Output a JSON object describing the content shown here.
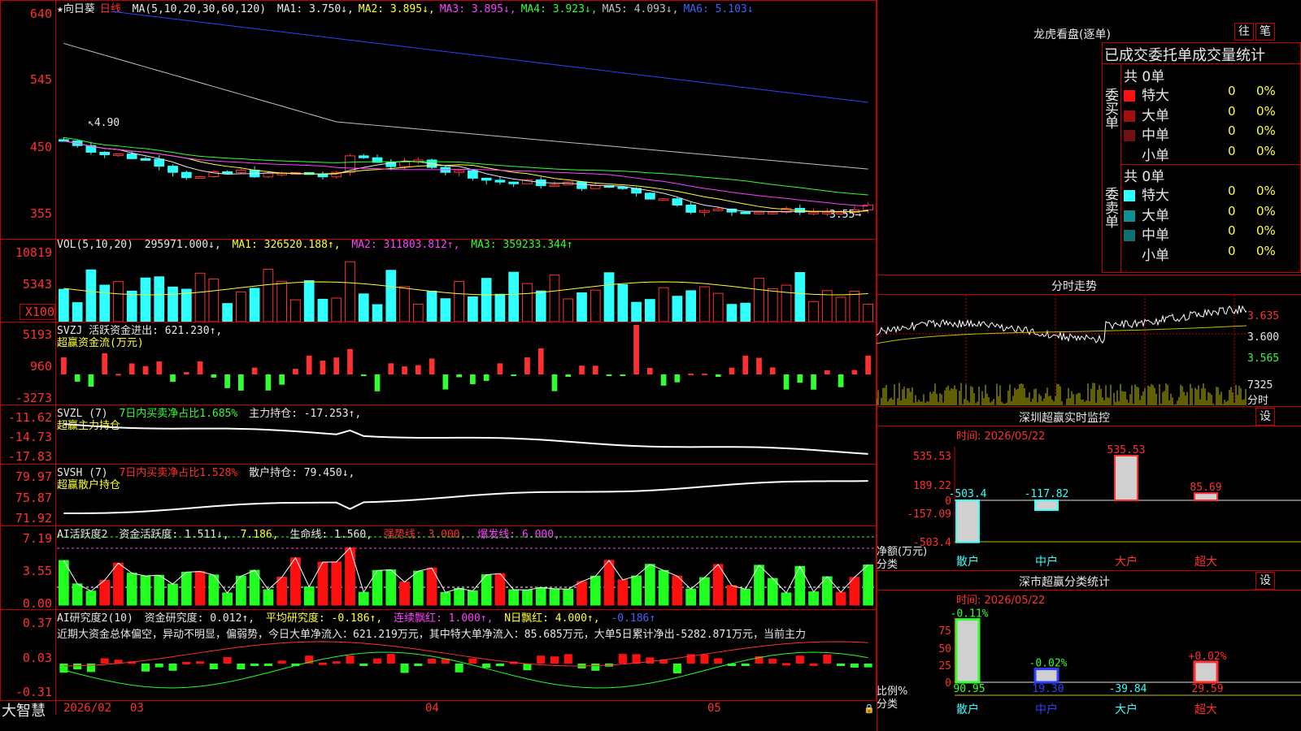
{
  "main": {
    "stock_name": "★向日葵",
    "period": "日线",
    "ma_label": "MA(5,10,20,30,60,120)",
    "ma_values": [
      {
        "text": "MA1: 3.750↓,",
        "color": "#e8e8e8"
      },
      {
        "text": "MA2: 3.895↓,",
        "color": "#ffff30"
      },
      {
        "text": "MA3: 3.895↓,",
        "color": "#ff40ff"
      },
      {
        "text": "MA4: 3.923↓,",
        "color": "#30ff30"
      },
      {
        "text": "MA5: 4.093↓,",
        "color": "#c0c0c0"
      },
      {
        "text": "MA6: 5.103↓",
        "color": "#4060ff"
      }
    ],
    "y_ticks": [
      "640",
      "545",
      "450",
      "355"
    ],
    "high_mark": "4.90",
    "low_mark": "3.55"
  },
  "vol": {
    "header": "VOL(5,10,20)",
    "value": "295971.000↓,",
    "ma1": "MA1: 326520.188↑,",
    "ma2": "MA2: 311803.812↑,",
    "ma3": "MA3: 359233.344↑",
    "y_ticks": [
      "10819",
      "5343",
      "X100"
    ]
  },
  "svzj": {
    "header": "SVZJ  活跃资金进出: 621.230↑,",
    "sub": "超赢资金流(万元)",
    "y_ticks": [
      "5193",
      "960",
      "-3273"
    ]
  },
  "svzl": {
    "header": "SVZL (7)",
    "ratio": "7日内买卖净占比1.685%",
    "hold": "主力持仓: -17.253↑,",
    "sub": "超赢主力持仓",
    "y_ticks": [
      "-11.62",
      "-14.73",
      "-17.83"
    ]
  },
  "svsh": {
    "header": "SVSH (7)",
    "ratio": "7日内买卖净占比1.528%",
    "hold": "散户持仓: 79.450↓,",
    "sub": "超赢散户持仓",
    "y_ticks": [
      "79.97",
      "75.87",
      "71.92"
    ]
  },
  "ai1": {
    "header": "AI活跃度2",
    "a": "资金活跃度: 1.511↓,",
    "b": "7.186,",
    "c": "生命线: 1.560,",
    "d": "强势线: 3.000,",
    "e": "爆发线: 6.000,",
    "y_ticks": [
      "7.19",
      "3.55",
      "0.00"
    ]
  },
  "ai2": {
    "header": "AI研究度2(10)",
    "a": "资金研究度: 0.012↑,",
    "b": "平均研究度: -0.186↑,",
    "c": "连续飘红: 1.000↑,",
    "d": "N日飘红: 4.000↑,",
    "e": "-0.186↑",
    "text": "近期大资金总体偏空，异动不明显，偏弱势，今日大单净流入：621.219万元，其中特大单净流入：85.685万元，大单5日累计净出-5282.871万元，当前主力",
    "y_ticks": [
      "0.37",
      "0.03",
      "-0.31"
    ]
  },
  "bottom": {
    "brand": "大智慧",
    "dates": [
      "2026/02",
      "03",
      "04",
      "05"
    ]
  },
  "right": {
    "dragon_title": "龙虎看盘(逐单)",
    "btn_wang": "往",
    "btn_bi": "笔",
    "stat_title": "已成交委托单成交量统计",
    "buy_label": "委买单",
    "sell_label": "委卖单",
    "buy_total": "共 0单",
    "sell_total": "共 0单",
    "buy_rows": [
      {
        "name": "特大",
        "num": "0",
        "pct": "0%",
        "color": "#ff1010"
      },
      {
        "name": "大单",
        "num": "0",
        "pct": "0%",
        "color": "#a01010"
      },
      {
        "name": "中单",
        "num": "0",
        "pct": "0%",
        "color": "#701010"
      },
      {
        "name": "小单",
        "num": "0",
        "pct": "0%",
        "color": "#000000"
      }
    ],
    "sell_rows": [
      {
        "name": "特大",
        "num": "0",
        "pct": "0%",
        "color": "#30ffff"
      },
      {
        "name": "大单",
        "num": "0",
        "pct": "0%",
        "color": "#109090"
      },
      {
        "name": "中单",
        "num": "0",
        "pct": "0%",
        "color": "#107070"
      },
      {
        "name": "小单",
        "num": "0",
        "pct": "0%",
        "color": "#000000"
      }
    ],
    "intraday_title": "分时走势",
    "intraday_prices": [
      "3.635",
      "3.600",
      "3.565"
    ],
    "intraday_vol": "7325",
    "intraday_unit": "分时",
    "monitor_title": "深圳超赢实时监控",
    "monitor_btn": "设",
    "monitor_time": "时间: 2026/05/22",
    "monitor_yticks": [
      "535.53",
      "189.22",
      "0",
      "-157.09",
      "-503.4"
    ],
    "monitor_unit1": "净额(万元)",
    "monitor_unit2": "分类",
    "monitor_bars": [
      {
        "cat": "散户",
        "value": -503.4,
        "label": "-503.4"
      },
      {
        "cat": "中户",
        "value": -117.82,
        "label": "-117.82"
      },
      {
        "cat": "大户",
        "value": 535.53,
        "label": "535.53"
      },
      {
        "cat": "超大",
        "value": 85.69,
        "label": "85.69"
      }
    ],
    "class_title": "深市超赢分类统计",
    "class_btn": "设",
    "class_time": "时间: 2026/05/22",
    "class_yticks": [
      "75",
      "50",
      "25",
      "0"
    ],
    "class_unit1": "比例%",
    "class_unit2": "分类",
    "class_bars": [
      {
        "cat": "散户",
        "value": 90.95,
        "top": "-0.11%",
        "bottom": "90.95"
      },
      {
        "cat": "中户",
        "value": 19.3,
        "top": "-0.02%",
        "bottom": "19.30"
      },
      {
        "cat": "大户",
        "value": 0,
        "top": "",
        "bottom": "-39.84"
      },
      {
        "cat": "超大",
        "value": 29.59,
        "top": "+0.02%",
        "bottom": "29.59"
      }
    ]
  }
}
